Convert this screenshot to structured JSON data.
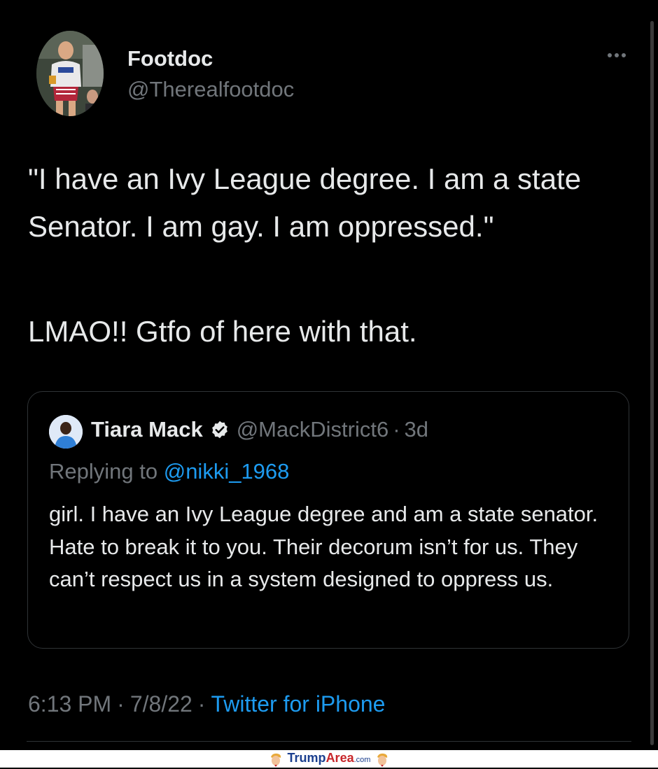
{
  "author": {
    "display_name": "Footdoc",
    "handle": "@Therealfootdoc"
  },
  "tweet": {
    "text_1": "\"I have an Ivy League degree. I am a state Senator. I am gay. I am oppressed.\"",
    "text_2": "LMAO!! Gtfo of here with that."
  },
  "quoted_tweet": {
    "display_name": "Tiara Mack",
    "handle": "@MackDistrict6",
    "separator": "·",
    "time": "3d",
    "replying_label": "Replying to",
    "replying_to": "@nikki_1968",
    "text": "girl. I have an Ivy League degree and am a state senator. Hate to break it to you. Their decorum isn’t for us. They can’t respect us in a system designed to oppress us."
  },
  "meta": {
    "time": "6:13 PM",
    "separator": "·",
    "date": "7/8/22",
    "source": "Twitter for iPhone"
  },
  "footer": {
    "brand_part1": "Trump",
    "brand_part2": "Area",
    "brand_part3": ".com"
  },
  "colors": {
    "background": "#000000",
    "text": "#e7e9ea",
    "muted": "#71767b",
    "link": "#1d9bf0",
    "border": "#2f3336"
  },
  "icons": [
    "more-icon",
    "verified-icon",
    "trump-icon"
  ]
}
